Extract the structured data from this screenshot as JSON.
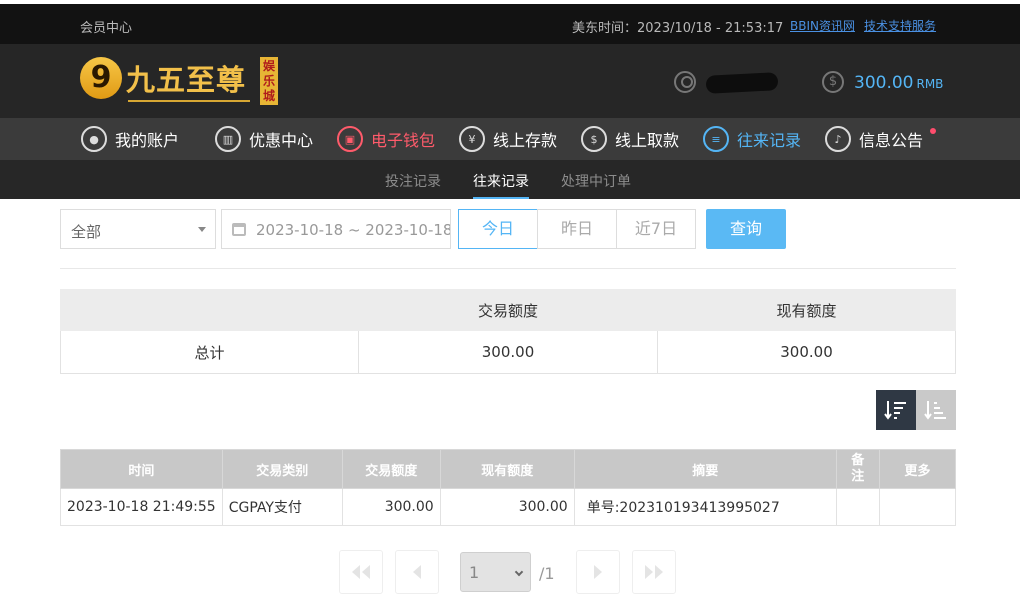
{
  "topbar": {
    "member_center": "会员中心",
    "time_label": "美东时间：2023/10/18 - 21:53:17",
    "link_news": "BBIN资讯网",
    "link_support": "技术支持服务"
  },
  "header": {
    "logo_text": "九五至尊",
    "logo_badge": "娱乐城",
    "logo_number": "9",
    "balance": "300.00",
    "currency": "RMB"
  },
  "nav": {
    "items": [
      {
        "label": "我的账户",
        "icon": "user-icon"
      },
      {
        "label": "优惠中心",
        "icon": "gift-icon"
      },
      {
        "label": "电子钱包",
        "icon": "wallet-icon"
      },
      {
        "label": "线上存款",
        "icon": "deposit-icon"
      },
      {
        "label": "线上取款",
        "icon": "withdraw-icon"
      },
      {
        "label": "往来记录",
        "icon": "record-icon"
      },
      {
        "label": "信息公告",
        "icon": "bell-icon"
      }
    ]
  },
  "subnav": {
    "tabs": [
      "投注记录",
      "往来记录",
      "处理中订单"
    ]
  },
  "filters": {
    "type_value": "全部",
    "date_range": "2023-10-18 ~ 2023-10-18",
    "today": "今日",
    "yesterday": "昨日",
    "last7": "近7日",
    "query": "查询"
  },
  "summary": {
    "headers": [
      "",
      "交易额度",
      "现有额度"
    ],
    "row_label": "总计",
    "trade_amount": "300.00",
    "current_amount": "300.00"
  },
  "records": {
    "headers": [
      "时间",
      "交易类别",
      "交易额度",
      "现有额度",
      "摘要",
      "备注",
      "更多"
    ],
    "rows": [
      {
        "time": "2023-10-18 21:49:55",
        "type": "CGPAY支付",
        "amount": "300.00",
        "balance": "300.00",
        "summary": "单号:202310193413995027",
        "note": "",
        "more": ""
      }
    ]
  },
  "pager": {
    "current": "1",
    "total": "/1"
  },
  "colors": {
    "accent_blue": "#54b5f5",
    "accent_red": "#ff5b6b",
    "gold": "#f2c04a"
  }
}
